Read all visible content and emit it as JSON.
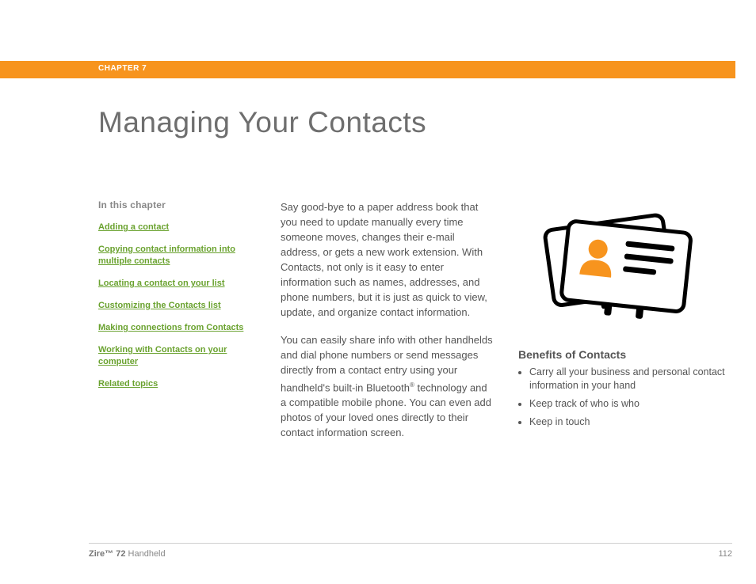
{
  "chapter_label": "CHAPTER 7",
  "page_title": "Managing Your Contacts",
  "sidebar": {
    "heading": "In this chapter",
    "links": [
      "Adding a contact",
      "Copying contact information into multiple contacts",
      "Locating a contact on your list",
      "Customizing the Contacts list",
      "Making connections from Contacts",
      "Working with Contacts on your computer",
      "Related topics"
    ]
  },
  "body": {
    "para1": "Say good-bye to a paper address book that you need to update manually every time someone moves, changes their e-mail address, or gets a new work extension. With Contacts, not only is it easy to enter information such as names, addresses, and phone numbers, but it is just as quick to view, update, and organize contact information.",
    "para2_a": "You can easily share info with other handhelds and dial phone numbers or send messages directly from a contact entry using your handheld's built-in Bluetooth",
    "para2_reg": "®",
    "para2_b": " technology and a compatible mobile phone. You can even add photos of your loved ones directly to their contact information screen."
  },
  "right": {
    "benefits_heading": "Benefits of Contacts",
    "benefits": [
      "Carry all your business and personal contact information in your hand",
      "Keep track of who is who",
      "Keep in touch"
    ]
  },
  "footer": {
    "product_bold": "Zire™ 72",
    "product_rest": " Handheld",
    "page_number": "112"
  },
  "colors": {
    "accent": "#f7941e",
    "link": "#6aa22f"
  }
}
